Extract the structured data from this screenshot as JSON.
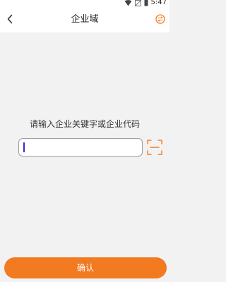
{
  "status_bar": {
    "time": "5:47",
    "icons": [
      "wifi-icon",
      "no-signal-icon",
      "battery-icon"
    ]
  },
  "header": {
    "title": "企业域",
    "back_icon": "chevron-left-icon",
    "action_icon": "switch-icon"
  },
  "main": {
    "prompt": "请输入企业关键字或企业代码",
    "input": {
      "value": "",
      "placeholder": ""
    },
    "scan_icon": "scan-icon"
  },
  "footer": {
    "confirm_label": "确认"
  },
  "colors": {
    "accent": "#f27a21",
    "background": "#f2f2f2",
    "caret": "#3b2bd1"
  }
}
